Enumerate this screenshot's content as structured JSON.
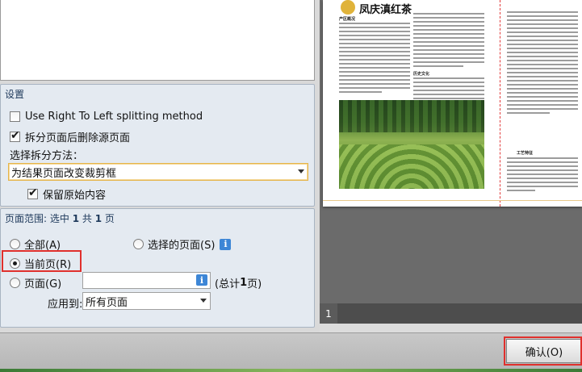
{
  "settings": {
    "group_title": "设置",
    "rtl_label": "Use Right To Left splitting method",
    "rtl_checked": false,
    "delete_source_label": "拆分页面后删除源页面",
    "delete_source_checked": true,
    "split_method_label": "选择拆分方法：",
    "split_method_value": "为结果页面改变裁剪框",
    "keep_content_label": "保留原始内容",
    "keep_content_checked": true
  },
  "page_range": {
    "title_prefix": "页面范围: 选中 ",
    "selected": "1",
    "title_mid": " 共 ",
    "total": "1",
    "title_suffix": " 页",
    "all_label": "全部(A)",
    "selected_pages_label": "选择的页面(S)",
    "current_page_label": "当前页(R)",
    "pages_label": "页面(G)",
    "pages_input_value": "",
    "total_prefix": "(总计 ",
    "total_count": "1",
    "total_suffix": " 页)",
    "apply_to_label": "应用到:",
    "apply_to_value": "所有页面",
    "selected_option": "current"
  },
  "preview": {
    "article_title": "凤庆滇红茶",
    "heading_1": "产区概况",
    "heading_2": "历史文化",
    "heading_3": "工艺特征",
    "page_number": "1"
  },
  "footer": {
    "ok_label": "确认(O)"
  },
  "colors": {
    "highlight_red": "#e0302d",
    "group_bg": "#e4eaf1",
    "title_blue": "#1e395b",
    "info_blue": "#3d86d6",
    "viewer_bg": "#6b6b6b"
  },
  "icons": [
    "info-icon",
    "dropdown-arrow-icon",
    "checkbox-icon",
    "radio-icon",
    "tea-logo-icon"
  ]
}
